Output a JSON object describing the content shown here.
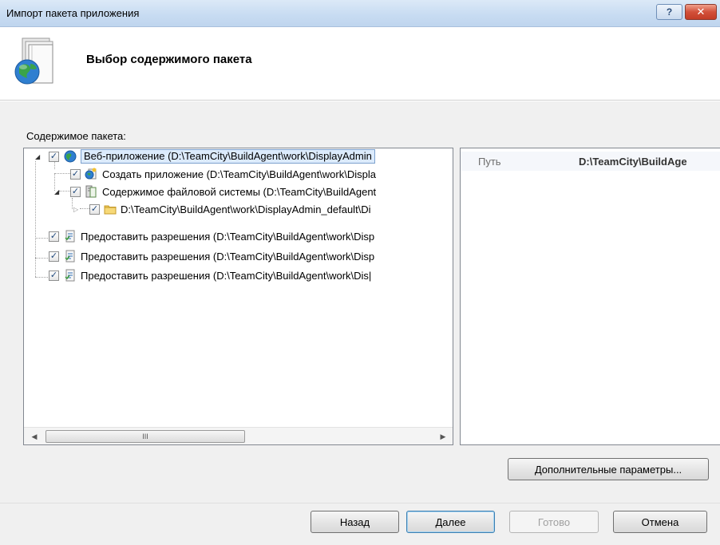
{
  "window": {
    "title": "Импорт пакета приложения",
    "help_label": "?",
    "close_label": "✕"
  },
  "header": {
    "title": "Выбор содержимого пакета",
    "icon": "package-globe-icon"
  },
  "content": {
    "label": "Содержимое пакета:"
  },
  "tree": {
    "nodes": [
      {
        "label": "Веб-приложение (D:\\TeamCity\\BuildAgent\\work\\DisplayAdmin",
        "checked": true,
        "expanded": true,
        "icon": "globe-icon"
      },
      {
        "label": "Создать приложение (D:\\TeamCity\\BuildAgent\\work\\Displa",
        "checked": true,
        "icon": "create-app-icon"
      },
      {
        "label": "Содержимое файловой системы (D:\\TeamCity\\BuildAgent",
        "checked": true,
        "expanded": true,
        "icon": "filesystem-icon"
      },
      {
        "label": "D:\\TeamCity\\BuildAgent\\work\\DisplayAdmin_default\\Di",
        "checked": true,
        "expanded": false,
        "icon": "folder-icon"
      },
      {
        "label": "Предоставить разрешения (D:\\TeamCity\\BuildAgent\\work\\Disp",
        "checked": true,
        "icon": "permissions-icon"
      },
      {
        "label": "Предоставить разрешения (D:\\TeamCity\\BuildAgent\\work\\Disp",
        "checked": true,
        "icon": "permissions-icon"
      },
      {
        "label": "Предоставить разрешения (D:\\TeamCity\\BuildAgent\\work\\Dis|",
        "checked": true,
        "icon": "permissions-icon"
      }
    ],
    "scroll_thumb_grip": "III"
  },
  "properties": {
    "rows": [
      {
        "name": "Путь",
        "value": "D:\\TeamCity\\BuildAge"
      }
    ]
  },
  "buttons": {
    "advanced": "Дополнительные параметры...",
    "back": "Назад",
    "next": "Далее",
    "finish": "Готово",
    "cancel": "Отмена"
  }
}
